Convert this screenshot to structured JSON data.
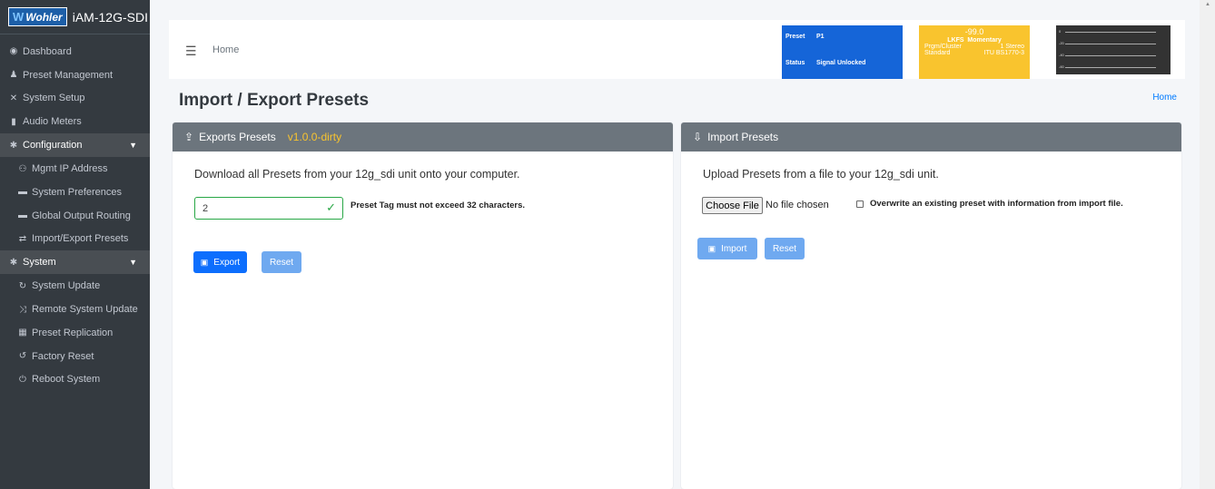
{
  "brand": {
    "logo": "Wohler",
    "title": "iAM-12G-SDI"
  },
  "sidebar": {
    "items": [
      {
        "label": "Dashboard",
        "icon": "dashboard-icon",
        "glyph": "◉"
      },
      {
        "label": "Preset Management",
        "icon": "user-preset-icon",
        "glyph": "♟"
      },
      {
        "label": "System Setup",
        "icon": "tools-icon",
        "glyph": "✕"
      },
      {
        "label": "Audio Meters",
        "icon": "meter-icon",
        "glyph": "▮"
      }
    ],
    "configuration": {
      "label": "Configuration",
      "items": [
        {
          "label": "Mgmt IP Address",
          "glyph": "⚇"
        },
        {
          "label": "System Preferences",
          "glyph": "▬"
        },
        {
          "label": "Global Output Routing",
          "glyph": "▬"
        },
        {
          "label": "Import/Export Presets",
          "glyph": "⇄"
        }
      ]
    },
    "system": {
      "label": "System",
      "items": [
        {
          "label": "System Update",
          "glyph": "↻"
        },
        {
          "label": "Remote System Update",
          "glyph": "⤨"
        },
        {
          "label": "Preset Replication",
          "glyph": "▦"
        },
        {
          "label": "Factory Reset",
          "glyph": "↺"
        },
        {
          "label": "Reboot System",
          "glyph": "⏻"
        }
      ]
    }
  },
  "header": {
    "home_label": "Home",
    "preset": {
      "preset_label": "Preset",
      "preset_value": "P1",
      "status_label": "Status",
      "status_value": "Signal Unlocked"
    },
    "lkfs": {
      "value": "-99.0",
      "unit": "LKFS",
      "mode": "Momentary",
      "cluster_label": "Prgm/Cluster",
      "cluster_value": "1  Stereo",
      "standard_label": "Standard",
      "standard_value": "ITU BS1770-3"
    }
  },
  "page": {
    "title": "Import / Export Presets",
    "breadcrumb": "Home"
  },
  "export_card": {
    "title": "Exports Presets",
    "version": "v1.0.0-dirty",
    "description": "Download all Presets from your 12g_sdi unit onto your computer.",
    "tag_value": "2",
    "tag_hint": "Preset Tag must not exceed 32 characters.",
    "export_button": "Export",
    "reset_button": "Reset"
  },
  "import_card": {
    "title": "Import Presets",
    "description": "Upload Presets from a file to your 12g_sdi unit.",
    "choose_file": "Choose File",
    "file_status": "No file chosen",
    "overwrite_label": "Overwrite an existing preset with information from import file.",
    "import_button": "Import",
    "reset_button": "Reset"
  }
}
